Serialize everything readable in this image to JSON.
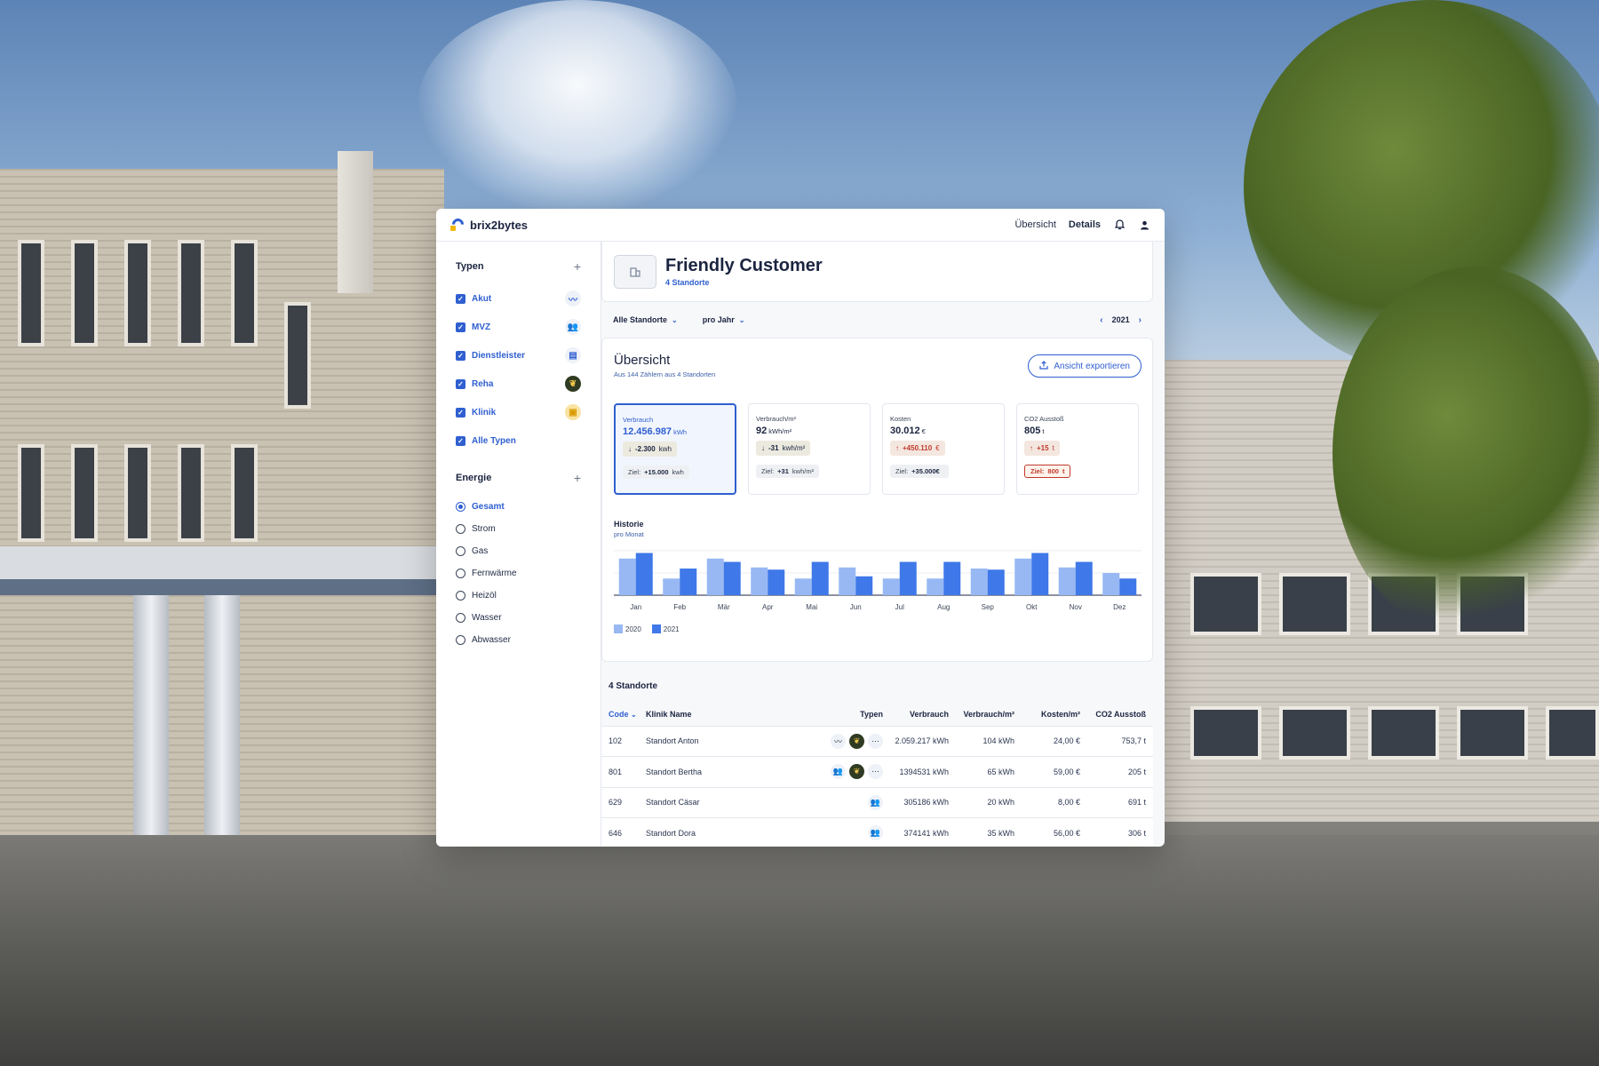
{
  "brand": {
    "name": "brix2bytes",
    "accent": "#2f5fd0",
    "logo_dot": "#f2b705"
  },
  "nav": {
    "overview": "Übersicht",
    "details": "Details",
    "bell_icon": "bell-icon",
    "user_icon": "user-icon"
  },
  "sidebar": {
    "types_title": "Typen",
    "types": [
      {
        "label": "Akut",
        "icon": "trend-icon",
        "glyph": "〰"
      },
      {
        "label": "MVZ",
        "icon": "people-icon",
        "glyph": "👥"
      },
      {
        "label": "Dienstleister",
        "icon": "document-icon",
        "glyph": "▤"
      },
      {
        "label": "Reha",
        "icon": "leaf-icon",
        "glyph": "❦"
      },
      {
        "label": "Klinik",
        "icon": "clinic-icon",
        "glyph": "▣"
      },
      {
        "label": "Alle Typen",
        "icon": "",
        "glyph": ""
      }
    ],
    "energy_title": "Energie",
    "energy": [
      "Gesamt",
      "Strom",
      "Gas",
      "Fernwärme",
      "Heizöl",
      "Wasser",
      "Abwasser"
    ],
    "energy_selected": "Gesamt"
  },
  "customer": {
    "name": "Friendly Customer",
    "subtitle": "4 Standorte"
  },
  "filters": {
    "sites": "Alle Standorte",
    "period": "pro Jahr",
    "year": "2021"
  },
  "overview": {
    "title": "Übersicht",
    "subtitle": "Aus 144 Zählern aus 4 Standorten",
    "export_label": "Ansicht exportieren",
    "kpis": [
      {
        "label": "Verbrauch",
        "value": "12.456.987",
        "unit": "kWh",
        "delta": "-2.300",
        "delta_unit": "kwh",
        "direction": "down",
        "target_label": "Ziel:",
        "target_value": "+15.000",
        "target_unit": "kwh",
        "warn": false
      },
      {
        "label": "Verbrauch/m²",
        "value": "92",
        "unit": "kWh/m²",
        "delta": "-31",
        "delta_unit": "kwh/m²",
        "direction": "down",
        "target_label": "Ziel:",
        "target_value": "+31",
        "target_unit": "kwh/m²",
        "warn": false
      },
      {
        "label": "Kosten",
        "value": "30.012",
        "unit": "€",
        "delta": "+450.110",
        "delta_unit": "€",
        "direction": "up",
        "target_label": "Ziel:",
        "target_value": "+35.000€",
        "target_unit": "",
        "warn": false
      },
      {
        "label": "CO2 Ausstoß",
        "value": "805",
        "unit": "t",
        "delta": "+15",
        "delta_unit": "t",
        "direction": "up",
        "target_label": "Ziel:",
        "target_value": "800",
        "target_unit": "t",
        "warn": true
      }
    ]
  },
  "history": {
    "title": "Historie",
    "subtitle": "pro Monat"
  },
  "chart_data": {
    "type": "bar",
    "categories": [
      "Jan",
      "Feb",
      "Mär",
      "Apr",
      "Mai",
      "Jun",
      "Jul",
      "Aug",
      "Sep",
      "Okt",
      "Nov",
      "Dez"
    ],
    "series": [
      {
        "name": "2020",
        "color": "#98b8f4",
        "values": [
          33,
          15,
          33,
          25,
          15,
          25,
          15,
          15,
          24,
          33,
          25,
          20
        ]
      },
      {
        "name": "2021",
        "color": "#3f78e8",
        "values": [
          38,
          24,
          30,
          23,
          30,
          17,
          30,
          30,
          23,
          38,
          30,
          15
        ]
      }
    ],
    "ylim": [
      0,
      40
    ],
    "grid": true,
    "legend": "bottom-left"
  },
  "sites": {
    "title": "4 Standorte",
    "columns": [
      "Code",
      "Klinik Name",
      "Typen",
      "Verbrauch",
      "Verbrauch/m²",
      "Kosten/m²",
      "CO2 Ausstoß"
    ],
    "rows": [
      {
        "code": "102",
        "name": "Standort Anton",
        "types": [
          "trend-icon",
          "leaf-icon",
          "more-icon"
        ],
        "consumption": "2.059.217 kWh",
        "per_m2": "104 kWh",
        "cost_m2": "24,00 €",
        "co2": "753,7 t"
      },
      {
        "code": "801",
        "name": "Standort Bertha",
        "types": [
          "people-icon",
          "leaf-icon",
          "more-icon"
        ],
        "consumption": "1394531 kWh",
        "per_m2": "65 kWh",
        "cost_m2": "59,00 €",
        "co2": "205 t"
      },
      {
        "code": "629",
        "name": "Standort Cäsar",
        "types": [
          "people-icon"
        ],
        "consumption": "305186 kWh",
        "per_m2": "20 kWh",
        "cost_m2": "8,00 €",
        "co2": "691 t"
      },
      {
        "code": "646",
        "name": "Standort Dora",
        "types": [
          "people-icon"
        ],
        "consumption": "374141 kWh",
        "per_m2": "35 kWh",
        "cost_m2": "56,00 €",
        "co2": "306 t"
      }
    ]
  }
}
